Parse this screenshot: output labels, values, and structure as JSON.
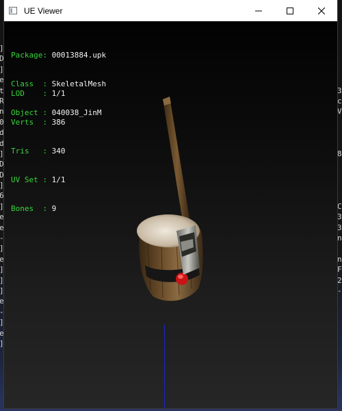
{
  "window": {
    "title": "UE Viewer"
  },
  "info_block_a": [
    {
      "label": "Package: ",
      "value": "00013884.upk"
    },
    {
      "label": "Class  : ",
      "value": "SkeletalMesh"
    },
    {
      "label": "Object : ",
      "value": "040038_JinM"
    }
  ],
  "info_block_b": [
    {
      "label": "LOD    : ",
      "value": "1/1"
    },
    {
      "label": "Verts  : ",
      "value": "386"
    },
    {
      "label": "Tris   : ",
      "value": "340"
    },
    {
      "label": "UV Set : ",
      "value": "1/1"
    },
    {
      "label": "Bones  : ",
      "value": "9"
    }
  ],
  "background_left_chars": [
    "]",
    "D",
    "]",
    "e",
    "t",
    "R",
    "n",
    "0",
    "d",
    "d",
    "]",
    "D",
    "D",
    "]",
    "6",
    "]",
    "e",
    "e",
    "-",
    "]",
    "e",
    "]",
    "]",
    "]",
    "e",
    "-",
    "]",
    "e",
    "]"
  ],
  "background_right_chars": [
    "",
    "",
    "",
    "",
    "3",
    "c",
    "V",
    "",
    "",
    "",
    "8",
    "",
    "",
    "",
    "",
    "C",
    "3",
    "3",
    "n",
    "",
    "n",
    "F",
    "2",
    "-",
    "",
    "",
    "",
    "",
    "",
    ""
  ],
  "icons": {
    "app": "app-window-icon",
    "minimize": "minimize-icon",
    "maximize": "maximize-icon",
    "close": "close-icon"
  }
}
